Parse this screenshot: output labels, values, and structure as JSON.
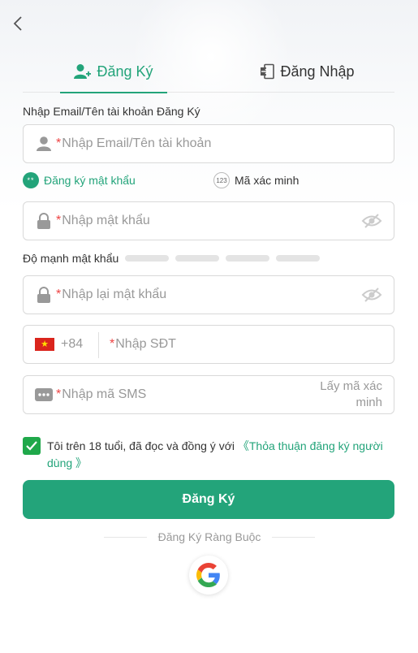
{
  "tabs": {
    "register": "Đăng Ký",
    "login": "Đăng Nhập"
  },
  "account": {
    "label": "Nhập Email/Tên tài khoản Đăng Ký",
    "required_mark": "*",
    "placeholder": "Nhập Email/Tên tài khoản"
  },
  "modes": {
    "password": "Đăng ký mật khẩu",
    "password_icon": "**",
    "code": "Mã xác minh",
    "code_icon": "123"
  },
  "password": {
    "required_mark": "*",
    "placeholder": "Nhập mật khẩu"
  },
  "strength": {
    "label": "Độ mạnh mật khẩu",
    "level": 0,
    "segments": 4
  },
  "confirm_password": {
    "required_mark": "*",
    "placeholder": "Nhập lại mật khẩu"
  },
  "phone": {
    "flag_icon": "vietnam-flag-icon",
    "flag_star": "★",
    "country_code": "+84",
    "required_mark": "*",
    "placeholder": "Nhập SĐT"
  },
  "sms": {
    "required_mark": "*",
    "placeholder": "Nhập mã SMS",
    "get_code": "Lấy mã xác minh"
  },
  "agreement": {
    "checked": true,
    "text": "Tôi trên 18 tuổi, đã đọc và đồng ý với ",
    "link": "《Thỏa thuận đăng ký người dùng 》"
  },
  "submit_label": "Đăng Ký",
  "bind": {
    "label": "Đăng Ký Ràng Buộc"
  },
  "colors": {
    "accent": "#23a47a",
    "checkbox": "#1fa84a",
    "required": "#ee4444",
    "placeholder": "#999999"
  }
}
